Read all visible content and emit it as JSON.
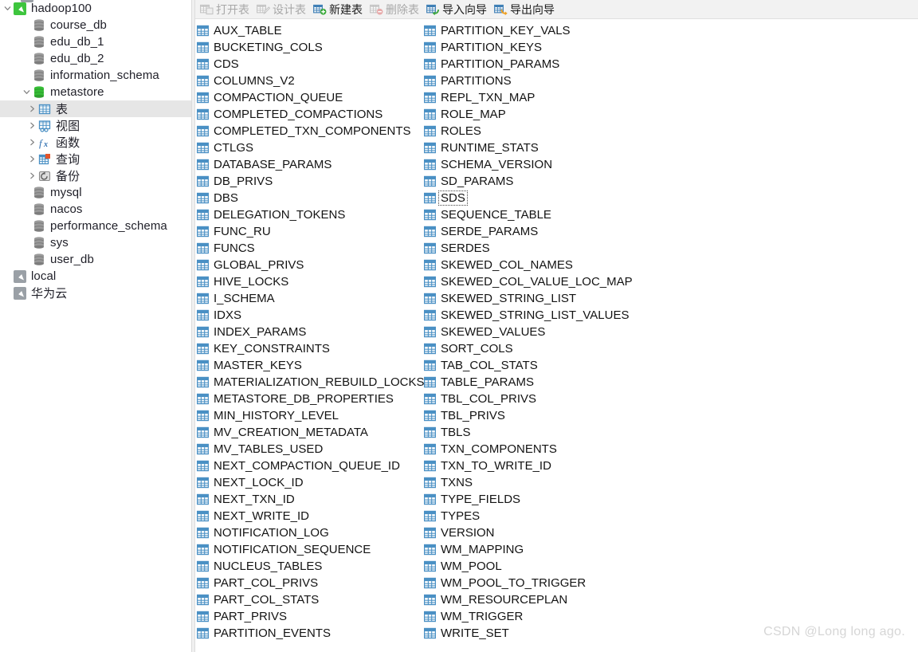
{
  "toolbar": {
    "buttons": [
      {
        "label": "打开表",
        "icon": "open-table-icon",
        "enabled": false
      },
      {
        "label": "设计表",
        "icon": "design-table-icon",
        "enabled": false
      },
      {
        "label": "新建表",
        "icon": "new-table-icon",
        "enabled": true
      },
      {
        "label": "删除表",
        "icon": "delete-table-icon",
        "enabled": false
      },
      {
        "label": "导入向导",
        "icon": "import-wizard-icon",
        "enabled": true
      },
      {
        "label": "导出向导",
        "icon": "export-wizard-icon",
        "enabled": true
      }
    ]
  },
  "sidebar": {
    "items": [
      {
        "label": "hadoop100",
        "icon": "connection-icon-green",
        "depth": 0,
        "twisty": "down",
        "selected": false
      },
      {
        "label": "course_db",
        "icon": "database-icon",
        "depth": 1,
        "twisty": "none",
        "selected": false
      },
      {
        "label": "edu_db_1",
        "icon": "database-icon",
        "depth": 1,
        "twisty": "none",
        "selected": false
      },
      {
        "label": "edu_db_2",
        "icon": "database-icon",
        "depth": 1,
        "twisty": "none",
        "selected": false
      },
      {
        "label": "information_schema",
        "icon": "database-icon",
        "depth": 1,
        "twisty": "none",
        "selected": false
      },
      {
        "label": "metastore",
        "icon": "database-icon-green",
        "depth": 1,
        "twisty": "down",
        "selected": false
      },
      {
        "label": "表",
        "icon": "tables-folder-icon",
        "depth": 2,
        "twisty": "right",
        "selected": true
      },
      {
        "label": "视图",
        "icon": "views-folder-icon",
        "depth": 2,
        "twisty": "right",
        "selected": false
      },
      {
        "label": "函数",
        "icon": "functions-folder-icon",
        "depth": 2,
        "twisty": "right",
        "selected": false
      },
      {
        "label": "查询",
        "icon": "queries-folder-icon",
        "depth": 2,
        "twisty": "right",
        "selected": false
      },
      {
        "label": "备份",
        "icon": "backups-folder-icon",
        "depth": 2,
        "twisty": "right",
        "selected": false
      },
      {
        "label": "mysql",
        "icon": "database-icon",
        "depth": 1,
        "twisty": "none",
        "selected": false
      },
      {
        "label": "nacos",
        "icon": "database-icon",
        "depth": 1,
        "twisty": "none",
        "selected": false
      },
      {
        "label": "performance_schema",
        "icon": "database-icon",
        "depth": 1,
        "twisty": "none",
        "selected": false
      },
      {
        "label": "sys",
        "icon": "database-icon",
        "depth": 1,
        "twisty": "none",
        "selected": false
      },
      {
        "label": "user_db",
        "icon": "database-icon",
        "depth": 1,
        "twisty": "none",
        "selected": false
      },
      {
        "label": "local",
        "icon": "connection-icon",
        "depth": 0,
        "twisty": "none",
        "selected": false
      },
      {
        "label": "华为云",
        "icon": "connection-icon",
        "depth": 0,
        "twisty": "none",
        "selected": false
      }
    ]
  },
  "tables": {
    "column1": [
      "AUX_TABLE",
      "BUCKETING_COLS",
      "CDS",
      "COLUMNS_V2",
      "COMPACTION_QUEUE",
      "COMPLETED_COMPACTIONS",
      "COMPLETED_TXN_COMPONENTS",
      "CTLGS",
      "DATABASE_PARAMS",
      "DB_PRIVS",
      "DBS",
      "DELEGATION_TOKENS",
      "FUNC_RU",
      "FUNCS",
      "GLOBAL_PRIVS",
      "HIVE_LOCKS",
      "I_SCHEMA",
      "IDXS",
      "INDEX_PARAMS",
      "KEY_CONSTRAINTS",
      "MASTER_KEYS",
      "MATERIALIZATION_REBUILD_LOCKS",
      "METASTORE_DB_PROPERTIES",
      "MIN_HISTORY_LEVEL",
      "MV_CREATION_METADATA",
      "MV_TABLES_USED",
      "NEXT_COMPACTION_QUEUE_ID",
      "NEXT_LOCK_ID",
      "NEXT_TXN_ID",
      "NEXT_WRITE_ID",
      "NOTIFICATION_LOG",
      "NOTIFICATION_SEQUENCE",
      "NUCLEUS_TABLES",
      "PART_COL_PRIVS",
      "PART_COL_STATS",
      "PART_PRIVS",
      "PARTITION_EVENTS"
    ],
    "column2": [
      "PARTITION_KEY_VALS",
      "PARTITION_KEYS",
      "PARTITION_PARAMS",
      "PARTITIONS",
      "REPL_TXN_MAP",
      "ROLE_MAP",
      "ROLES",
      "RUNTIME_STATS",
      "SCHEMA_VERSION",
      "SD_PARAMS",
      "SDS",
      "SEQUENCE_TABLE",
      "SERDE_PARAMS",
      "SERDES",
      "SKEWED_COL_NAMES",
      "SKEWED_COL_VALUE_LOC_MAP",
      "SKEWED_STRING_LIST",
      "SKEWED_STRING_LIST_VALUES",
      "SKEWED_VALUES",
      "SORT_COLS",
      "TAB_COL_STATS",
      "TABLE_PARAMS",
      "TBL_COL_PRIVS",
      "TBL_PRIVS",
      "TBLS",
      "TXN_COMPONENTS",
      "TXN_TO_WRITE_ID",
      "TXNS",
      "TYPE_FIELDS",
      "TYPES",
      "VERSION",
      "WM_MAPPING",
      "WM_POOL",
      "WM_POOL_TO_TRIGGER",
      "WM_RESOURCEPLAN",
      "WM_TRIGGER",
      "WRITE_SET"
    ],
    "focused_item": "SDS"
  },
  "watermark": {
    "text": "CSDN @Long long ago."
  },
  "colors": {
    "table_icon_blue": "#4a90c4",
    "selection_gray": "#e6e6e6",
    "connected_green": "#3ec53e",
    "toolbar_bg": "#f2f2f2",
    "watermark": "#d6d6d6"
  }
}
